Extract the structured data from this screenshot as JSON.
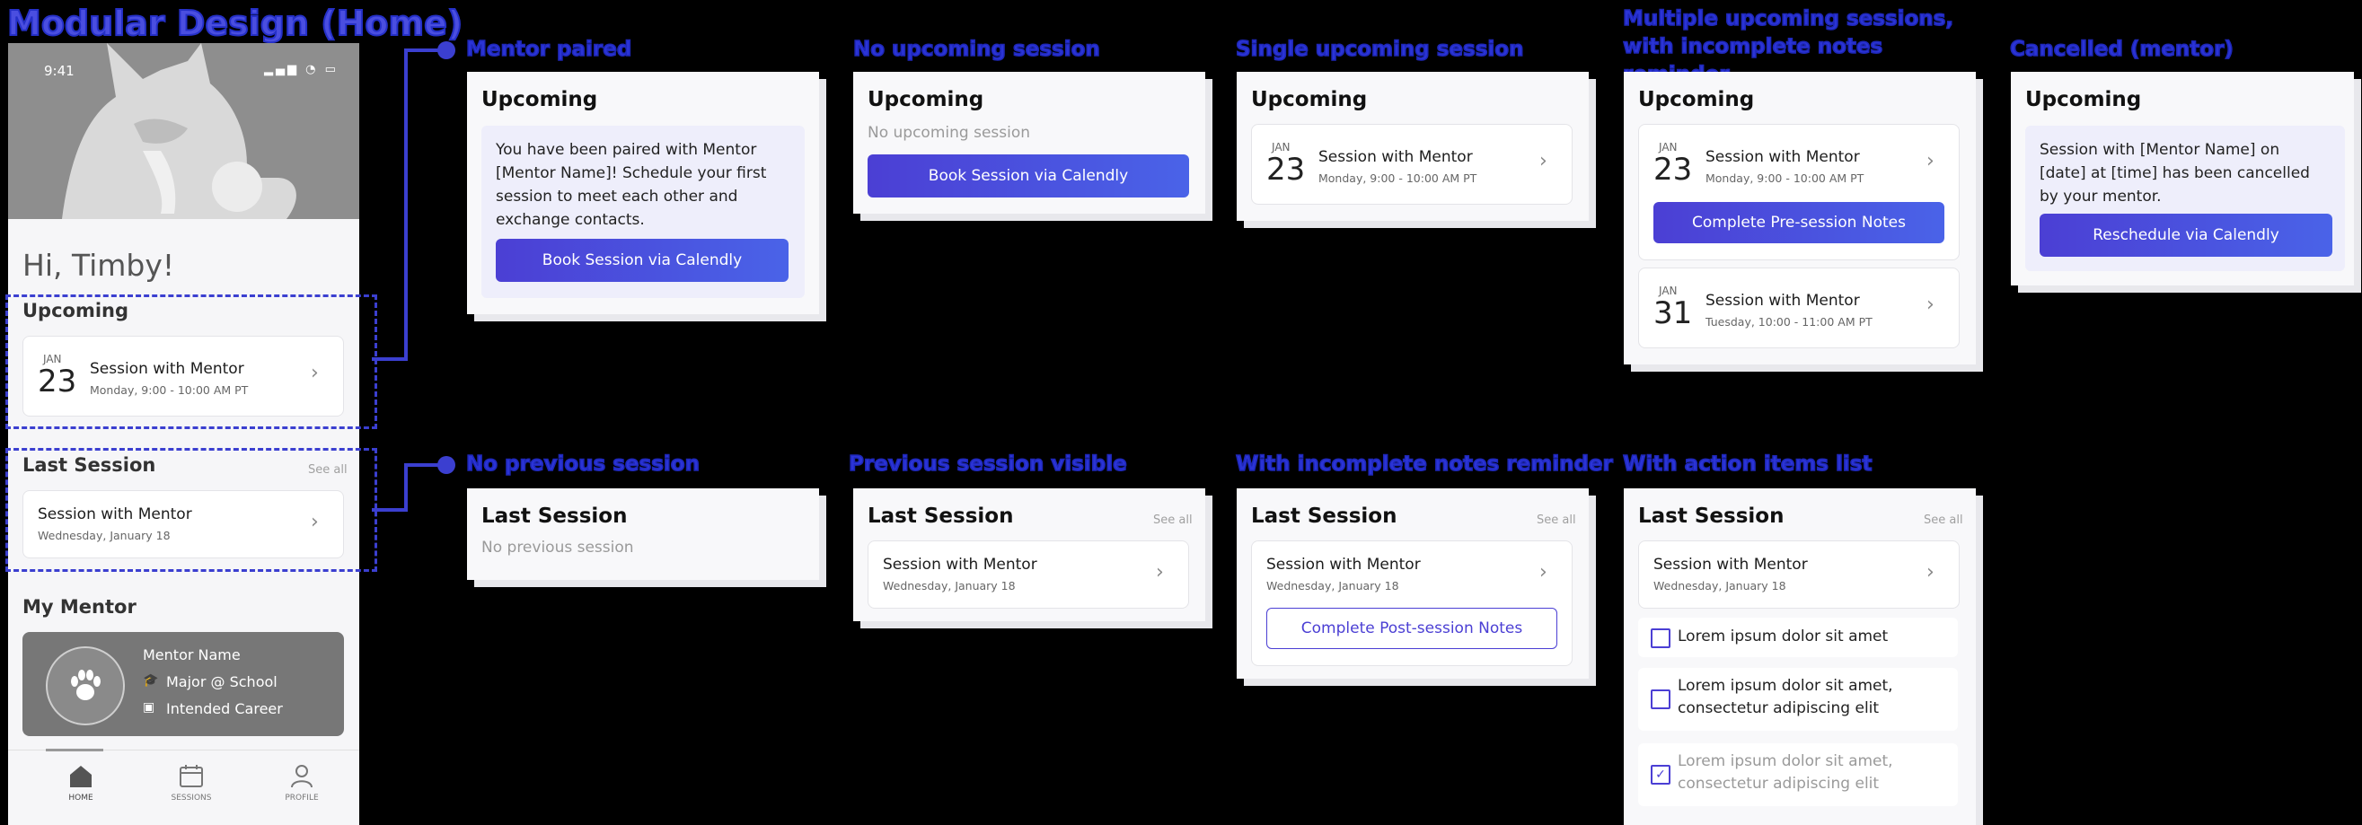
{
  "title": "Modular Design (Home)",
  "colors": {
    "accent": "#4b3fd4",
    "label": "#2b34d6",
    "dash": "#3b3fd0"
  },
  "phone": {
    "time": "9:41",
    "greeting": "Hi, Timby!",
    "upcoming_heading": "Upcoming",
    "upcoming_session": {
      "month": "JAN",
      "day": "23",
      "title": "Session with Mentor",
      "sub": "Monday, 9:00 - 10:00 AM PT"
    },
    "last_heading": "Last Session",
    "see_all": "See all",
    "last_session": {
      "title": "Session with Mentor",
      "sub": "Wednesday, January 18"
    },
    "mentor_heading": "My Mentor",
    "mentor": {
      "name": "Mentor Name",
      "major": "Major @ School",
      "career": "Intended Career"
    },
    "nav": [
      {
        "label": "HOME",
        "icon": "home-icon"
      },
      {
        "label": "SESSIONS",
        "icon": "calendar-icon"
      },
      {
        "label": "PROFILE",
        "icon": "profile-icon"
      }
    ]
  },
  "labels": {
    "mentor_paired": "Mentor paired",
    "no_upcoming": "No upcoming session",
    "single_upcoming": "Single upcoming session",
    "multiple_upcoming": "Multiple upcoming sessions, with incomplete notes reminder",
    "cancelled": "Cancelled (mentor)",
    "no_previous": "No previous session",
    "previous_visible": "Previous session visible",
    "with_notes_reminder": "With incomplete notes reminder",
    "with_action_items": "With action items list"
  },
  "cards": {
    "upcoming_heading": "Upcoming",
    "last_heading": "Last Session",
    "see_all": "See all",
    "paired_text": "You have been paired with Mentor [Mentor Name]! Schedule your first session to meet each other and exchange contacts.",
    "book_btn": "Book Session via Calendly",
    "no_upcoming_text": "No upcoming session",
    "session1": {
      "month": "JAN",
      "day": "23",
      "title": "Session with Mentor",
      "sub": "Monday, 9:00 - 10:00 AM PT"
    },
    "session2": {
      "month": "JAN",
      "day": "31",
      "title": "Session with Mentor",
      "sub": "Tuesday, 10:00 - 11:00 AM PT"
    },
    "pre_notes_btn": "Complete Pre-session Notes",
    "cancel_text": "Session with [Mentor Name] on [date] at [time] has been cancelled by your mentor.",
    "reschedule_btn": "Reschedule via Calendly",
    "no_previous_text": "No previous session",
    "last_session": {
      "title": "Session with Mentor",
      "sub": "Wednesday, January 18"
    },
    "post_notes_btn": "Complete Post-session Notes",
    "action_items": [
      {
        "text": "Lorem ipsum dolor sit amet",
        "checked": false
      },
      {
        "text": "Lorem ipsum dolor sit amet, consectetur adipiscing elit",
        "checked": false
      },
      {
        "text": "Lorem ipsum dolor sit amet, consectetur adipiscing elit",
        "checked": true
      }
    ]
  }
}
